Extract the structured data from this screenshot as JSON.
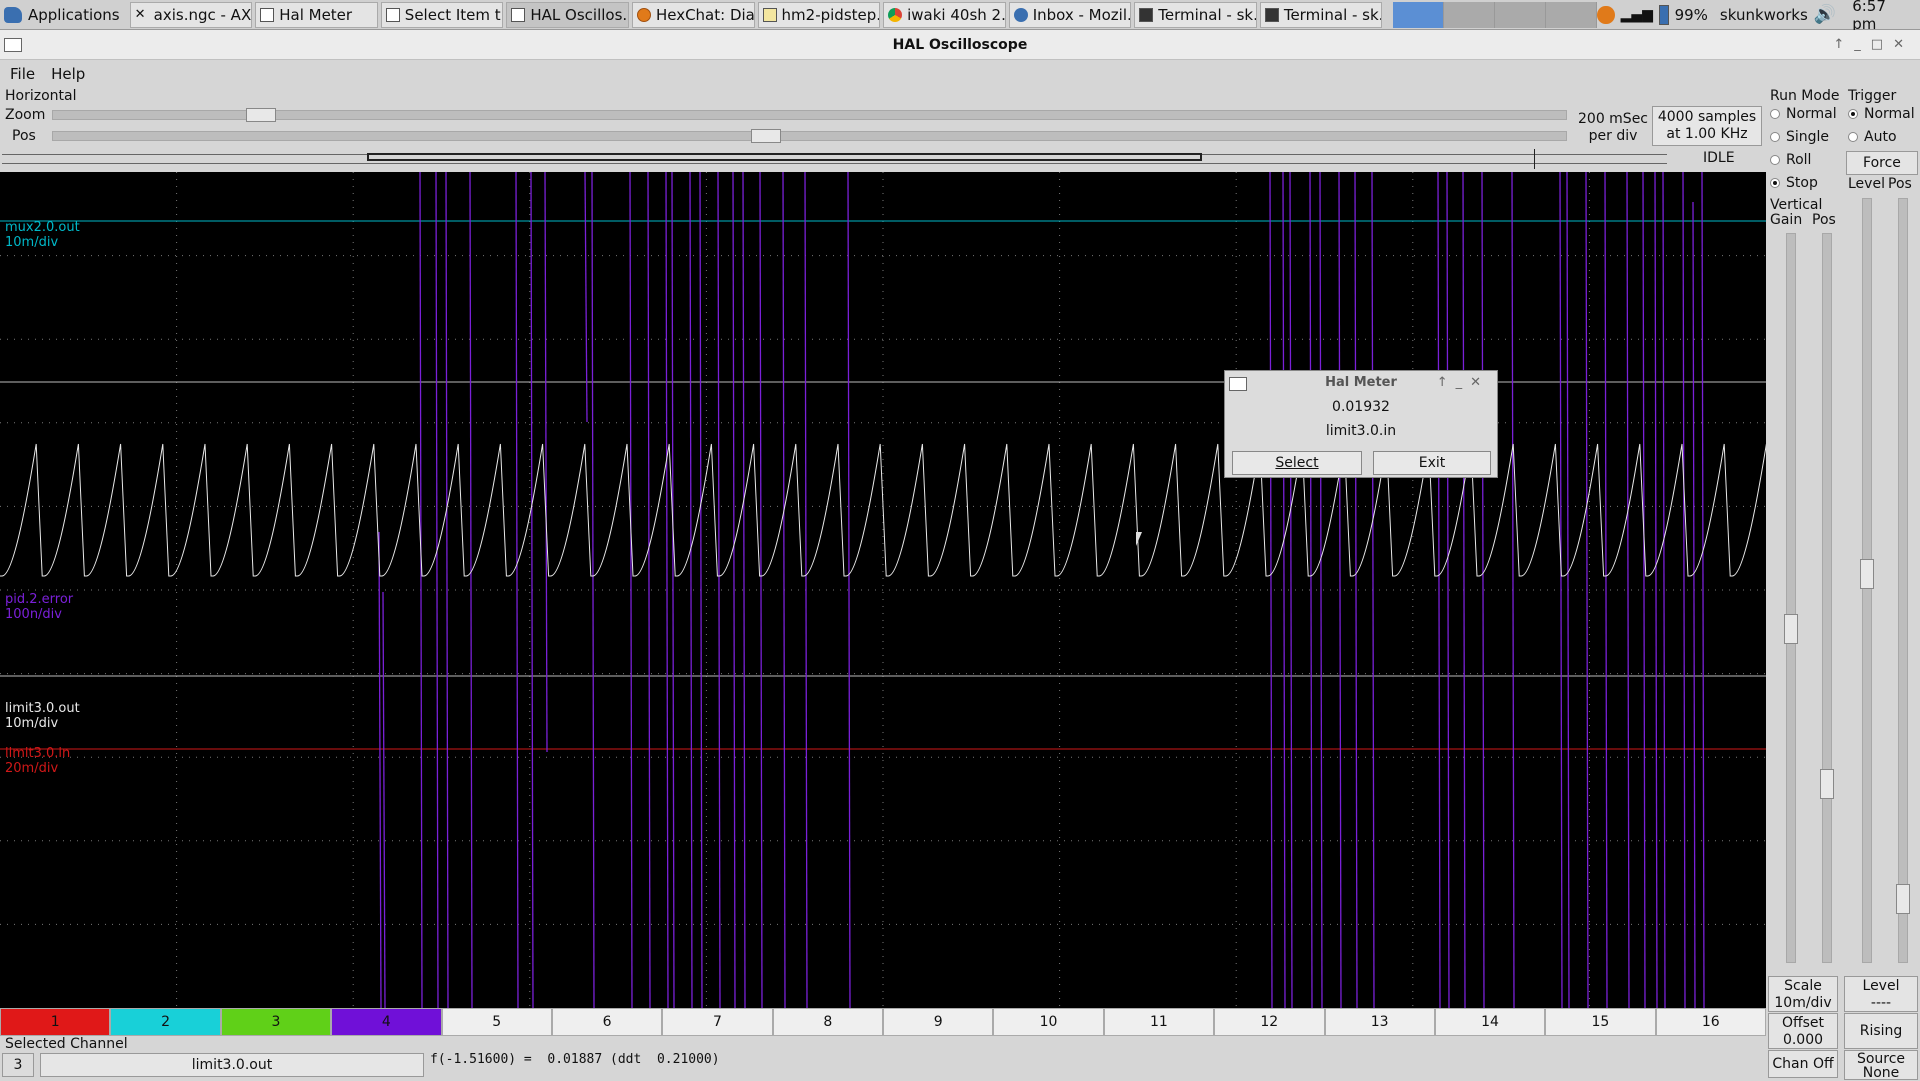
{
  "taskbar": {
    "apps_label": "Applications",
    "tasks": [
      {
        "label": "axis.ngc - AX...",
        "icon": "x-icon"
      },
      {
        "label": "Hal Meter",
        "icon": "window-icon"
      },
      {
        "label": "Select Item t...",
        "icon": "window-icon"
      },
      {
        "label": "HAL Oscillos...",
        "icon": "window-icon"
      },
      {
        "label": "HexChat: Dia...",
        "icon": "hexchat-icon"
      },
      {
        "label": "hm2-pidstep...",
        "icon": "editor-icon"
      },
      {
        "label": "iwaki 40sh 2...",
        "icon": "chrome-icon"
      },
      {
        "label": "Inbox - Mozil...",
        "icon": "thunderbird-icon"
      },
      {
        "label": "Terminal - sk...",
        "icon": "terminal-icon"
      },
      {
        "label": "Terminal - sk...",
        "icon": "terminal-icon"
      }
    ],
    "battery": "99%",
    "user": "skunkworks",
    "clock": "6:57 pm"
  },
  "window": {
    "title": "HAL Oscilloscope"
  },
  "menu": {
    "file": "File",
    "help": "Help"
  },
  "horizontal": {
    "section_label": "Horizontal",
    "zoom_label": "Zoom",
    "pos_label": "Pos",
    "timebase_line1": "200 mSec",
    "timebase_line2": "per div",
    "samples_line1": "4000 samples",
    "samples_line2": "at 1.00 KHz",
    "state": "IDLE",
    "zoom_position": 0.13,
    "pos_position": 0.47
  },
  "traces": [
    {
      "name": "mux2.0.out",
      "scale": "10m/div",
      "color": "#00b8c8"
    },
    {
      "name": "pid.2.error",
      "scale": "100n/div",
      "color": "#7a20d8"
    },
    {
      "name": "limit3.0.out",
      "scale": "10m/div",
      "color": "#e8e8e8"
    },
    {
      "name": "limit3.0.in",
      "scale": "20m/div",
      "color": "#d01818"
    }
  ],
  "halmeter": {
    "title": "Hal Meter",
    "value": "0.01932",
    "pin": "limit3.0.in",
    "select_label": "Select",
    "exit_label": "Exit"
  },
  "run_mode": {
    "label": "Run Mode",
    "options": [
      "Normal",
      "Single",
      "Roll",
      "Stop"
    ],
    "selected": "Stop"
  },
  "trigger": {
    "label": "Trigger",
    "options": [
      "Normal",
      "Auto"
    ],
    "selected": "Normal",
    "force_label": "Force",
    "level_label": "Level",
    "pos_label": "Pos",
    "level_bottom_label": "Level",
    "level_value": "----",
    "edge": "Rising",
    "source_label": "Source",
    "source_value": "None"
  },
  "vertical": {
    "label": "Vertical",
    "gain_label": "Gain",
    "pos_label": "Pos",
    "scale_label": "Scale",
    "scale_value": "10m/div",
    "offset_label": "Offset",
    "offset_value": "0.000",
    "chan_off_label": "Chan Off"
  },
  "channels": [
    {
      "label": "1",
      "color": "#e01818"
    },
    {
      "label": "2",
      "color": "#18d0d8"
    },
    {
      "label": "3",
      "color": "#60d018"
    },
    {
      "label": "4",
      "color": "#7010d8"
    },
    {
      "label": "5",
      "color": ""
    },
    {
      "label": "6",
      "color": ""
    },
    {
      "label": "7",
      "color": ""
    },
    {
      "label": "8",
      "color": ""
    },
    {
      "label": "9",
      "color": ""
    },
    {
      "label": "10",
      "color": ""
    },
    {
      "label": "11",
      "color": ""
    },
    {
      "label": "12",
      "color": ""
    },
    {
      "label": "13",
      "color": ""
    },
    {
      "label": "14",
      "color": ""
    },
    {
      "label": "15",
      "color": ""
    },
    {
      "label": "16",
      "color": ""
    }
  ],
  "selected_channel": {
    "label": "Selected Channel",
    "number": "3",
    "name": "limit3.0.out",
    "readout": "f(-1.51600) =  0.01887 (ddt  0.21000)"
  }
}
